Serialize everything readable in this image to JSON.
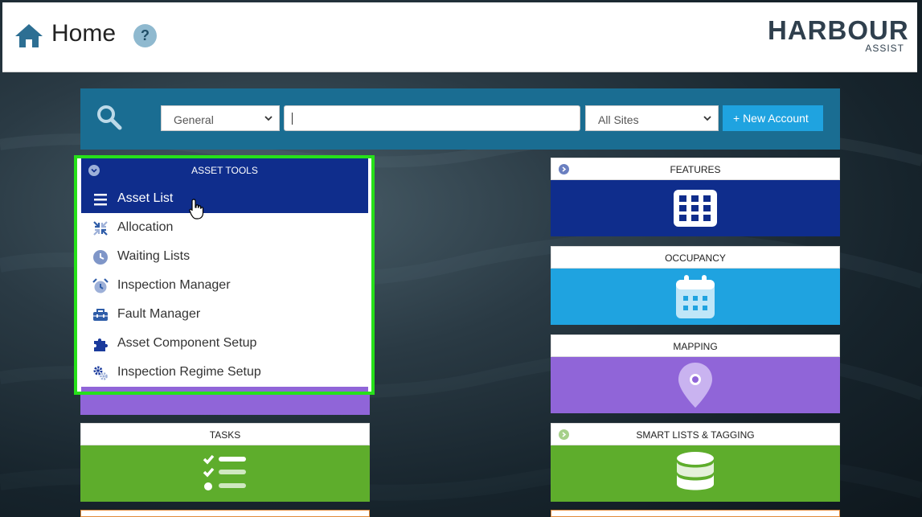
{
  "header": {
    "title": "Home",
    "help_label": "?",
    "logo_main": "HARBOUR",
    "logo_sub": "ASSIST"
  },
  "search": {
    "category_value": "General",
    "query_value": "",
    "site_value": "All Sites",
    "new_account_label": "+ New Account"
  },
  "asset_tools": {
    "title": "ASSET TOOLS",
    "items": [
      {
        "label": "Asset List",
        "icon": "hamburger-icon"
      },
      {
        "label": "Allocation",
        "icon": "compress-arrows-icon"
      },
      {
        "label": "Waiting Lists",
        "icon": "clock-icon"
      },
      {
        "label": "Inspection Manager",
        "icon": "alarm-clock-icon"
      },
      {
        "label": "Fault Manager",
        "icon": "toolbox-icon"
      },
      {
        "label": "Asset Component Setup",
        "icon": "puzzle-icon"
      },
      {
        "label": "Inspection Regime Setup",
        "icon": "cogs-icon"
      }
    ]
  },
  "tiles": {
    "tasks": {
      "title": "TASKS",
      "color": "#5ead2c",
      "icon": "task-list-icon"
    },
    "features": {
      "title": "FEATURES",
      "color": "#0f2d8c",
      "icon": "grid-icon"
    },
    "occupancy": {
      "title": "OCCUPANCY",
      "color": "#1fa3e0",
      "icon": "calendar-icon"
    },
    "mapping": {
      "title": "MAPPING",
      "color": "#9065d8",
      "icon": "map-pin-icon"
    },
    "smart_lists": {
      "title": "SMART LISTS & TAGGING",
      "color": "#5ead2c",
      "icon": "database-icon"
    }
  },
  "colors": {
    "header_bar": "#1a6d92",
    "accent_blue": "#1fa3e0",
    "navy": "#0f2d8c",
    "highlight_border": "#27e01a"
  }
}
